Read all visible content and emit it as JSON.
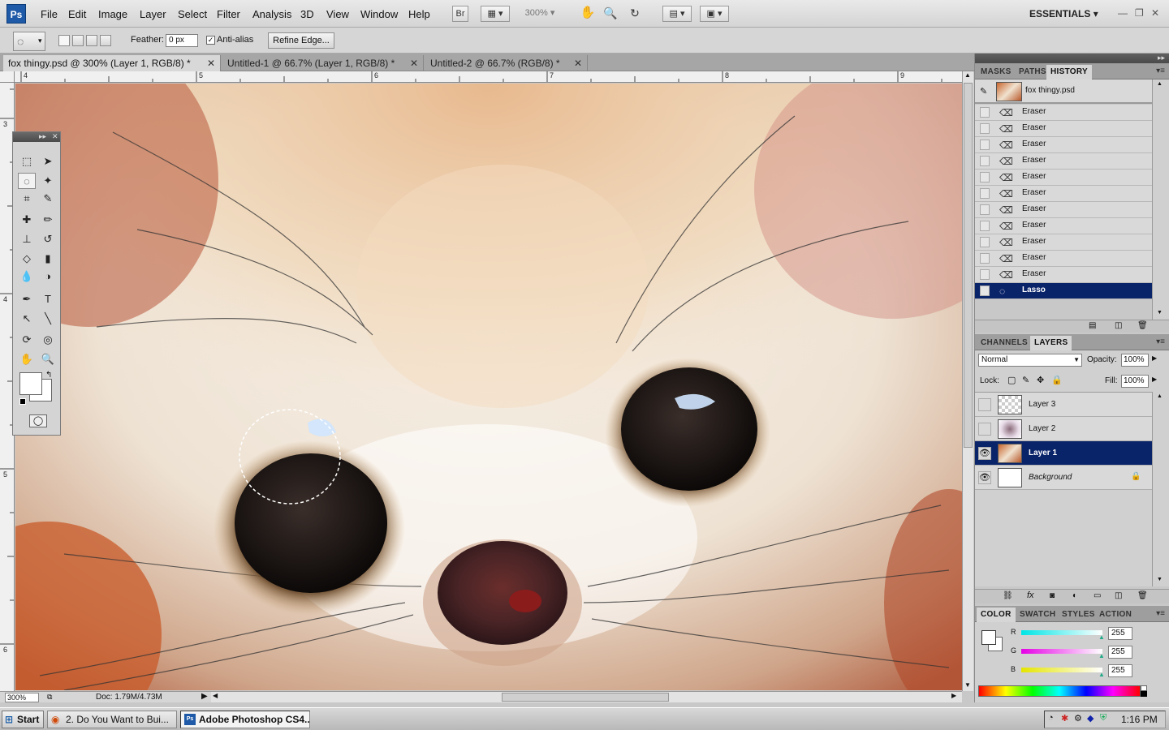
{
  "menubar": {
    "logo": "Ps",
    "items": [
      "File",
      "Edit",
      "Image",
      "Layer",
      "Select",
      "Filter",
      "Analysis",
      "3D",
      "View",
      "Window",
      "Help"
    ],
    "bridge_label": "Br",
    "zoom": "300%",
    "workspace": "ESSENTIALS"
  },
  "options": {
    "feather_label": "Feather:",
    "feather_value": "0 px",
    "antialias_label": "Anti-alias",
    "refine_label": "Refine Edge..."
  },
  "tabs": [
    {
      "label": "fox thingy.psd @ 300% (Layer 1, RGB/8) *",
      "active": true
    },
    {
      "label": "Untitled-1 @ 66.7% (Layer 1, RGB/8) *",
      "active": false
    },
    {
      "label": "Untitled-2 @ 66.7% (RGB/8) *",
      "active": false
    }
  ],
  "rulers": {
    "horizontal": [
      "4",
      "5",
      "6",
      "7",
      "8",
      "9"
    ],
    "vertical": [
      "3",
      "4",
      "5",
      "6"
    ]
  },
  "status": {
    "zoom": "300%",
    "doc": "Doc: 1.79M/4.73M"
  },
  "history_panel": {
    "tabs": [
      "MASKS",
      "PATHS",
      "HISTORY"
    ],
    "snapshot": "fox thingy.psd",
    "steps": [
      "Eraser",
      "Eraser",
      "Eraser",
      "Eraser",
      "Eraser",
      "Eraser",
      "Eraser",
      "Eraser",
      "Eraser",
      "Eraser",
      "Eraser",
      "Lasso"
    ]
  },
  "layers_panel": {
    "tabs": [
      "CHANNELS",
      "LAYERS"
    ],
    "blend_mode": "Normal",
    "opacity_label": "Opacity:",
    "opacity": "100%",
    "lock_label": "Lock:",
    "fill_label": "Fill:",
    "fill": "100%",
    "layers": [
      "Layer 3",
      "Layer 2",
      "Layer 1",
      "Background"
    ]
  },
  "color_panel": {
    "tabs": [
      "COLOR",
      "SWATCH",
      "STYLES",
      "ACTION"
    ],
    "r_label": "R",
    "r": "255",
    "g_label": "G",
    "g": "255",
    "b_label": "B",
    "b": "255"
  },
  "taskbar": {
    "start": "Start",
    "tasks": [
      "2. Do You Want to Bui...",
      "Adobe Photoshop CS4..."
    ],
    "clock": "1:16 PM"
  },
  "colors": {
    "selection": "#0a246a",
    "ps_blue": "#1e5aa8"
  }
}
